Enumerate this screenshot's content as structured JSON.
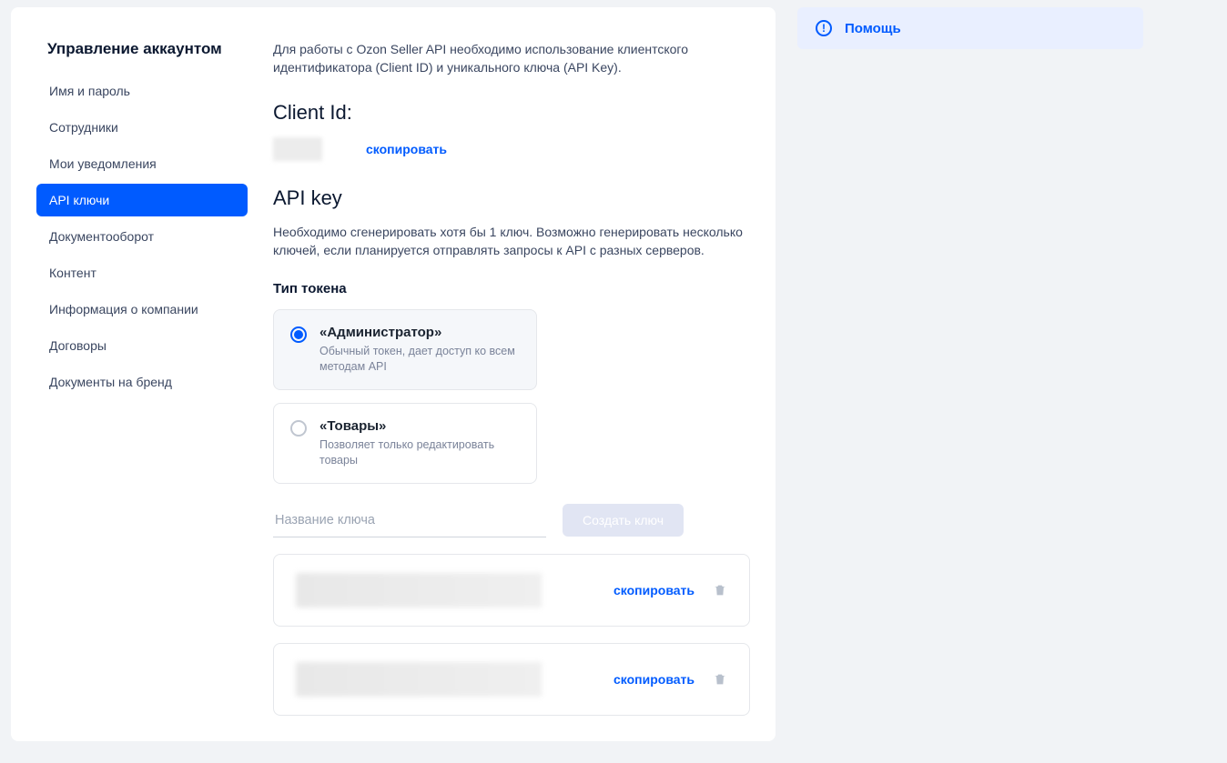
{
  "sidebar": {
    "title": "Управление аккаунтом",
    "items": [
      {
        "label": "Имя и пароль"
      },
      {
        "label": "Сотрудники"
      },
      {
        "label": "Мои уведомления"
      },
      {
        "label": "API ключи"
      },
      {
        "label": "Документооборот"
      },
      {
        "label": "Контент"
      },
      {
        "label": "Информация о компании"
      },
      {
        "label": "Договоры"
      },
      {
        "label": "Документы на бренд"
      }
    ]
  },
  "intro": "Для работы с Ozon Seller API необходимо использование клиентского идентификатора (Client ID) и уникального ключа (API Key).",
  "clientid": {
    "heading": "Client Id:",
    "copy": "скопировать"
  },
  "apikey": {
    "heading": "API key",
    "sub": "Необходимо сгенерировать хотя бы 1 ключ. Возможно генерировать несколько ключей, если планируется отправлять запросы к API с разных серверов.",
    "tokenTypeLabel": "Тип токена",
    "opts": [
      {
        "title": "«Администратор»",
        "sub": "Обычный токен, дает доступ ко всем методам API"
      },
      {
        "title": "«Товары»",
        "sub": "Позволяет только редактировать товары"
      }
    ],
    "placeholder": "Название ключа",
    "createBtn": "Создать ключ"
  },
  "keys": [
    {
      "copy": "скопировать"
    },
    {
      "copy": "скопировать"
    }
  ],
  "help": {
    "label": "Помощь"
  }
}
